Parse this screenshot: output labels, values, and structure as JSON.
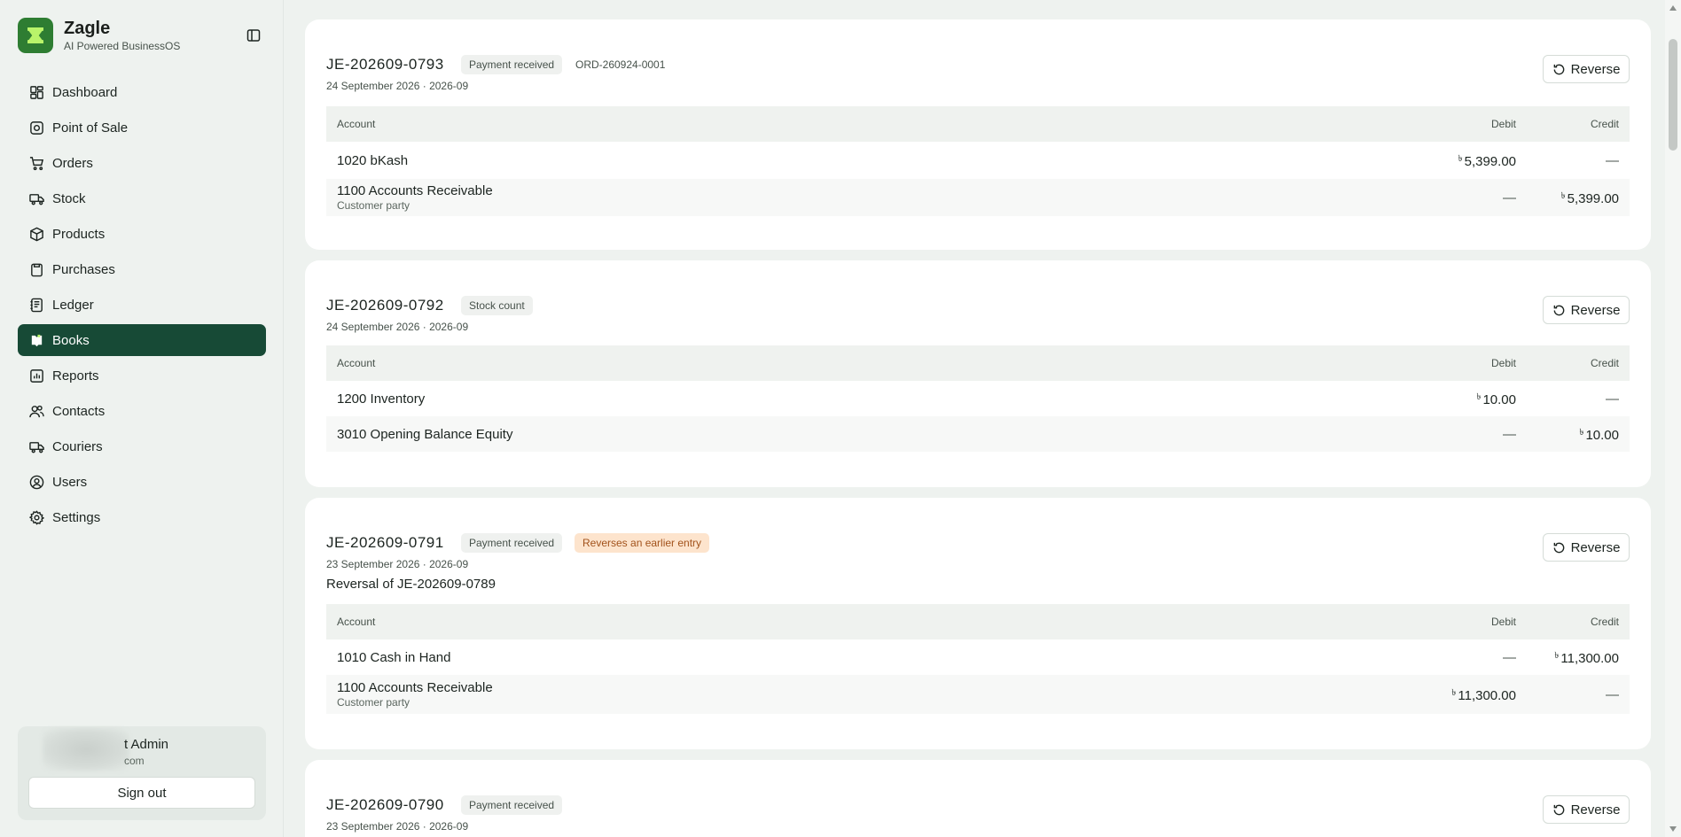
{
  "app": {
    "name": "Zagle",
    "tagline": "AI Powered BusinessOS"
  },
  "sidebar": {
    "items": [
      {
        "label": "Dashboard",
        "icon": "dashboard-icon"
      },
      {
        "label": "Point of Sale",
        "icon": "point-of-sale-icon"
      },
      {
        "label": "Orders",
        "icon": "cart-icon"
      },
      {
        "label": "Stock",
        "icon": "truck-icon"
      },
      {
        "label": "Products",
        "icon": "package-icon"
      },
      {
        "label": "Purchases",
        "icon": "clipboard-icon"
      },
      {
        "label": "Ledger",
        "icon": "book-icon"
      },
      {
        "label": "Books",
        "icon": "books-icon",
        "active": true
      },
      {
        "label": "Reports",
        "icon": "bar-chart-icon"
      },
      {
        "label": "Contacts",
        "icon": "users-icon"
      },
      {
        "label": "Couriers",
        "icon": "truck-icon"
      },
      {
        "label": "Users",
        "icon": "user-circle-icon"
      },
      {
        "label": "Settings",
        "icon": "gear-icon"
      }
    ]
  },
  "user": {
    "name_visible": "t Admin",
    "email_visible": "com",
    "signout_label": "Sign out"
  },
  "table_headers": {
    "account": "Account",
    "debit": "Debit",
    "credit": "Credit"
  },
  "currency_symbol": "৳",
  "reverse_label": "Reverse",
  "entries": [
    {
      "id": "JE-202609-0793",
      "badges": [
        "Payment received"
      ],
      "ref": "ORD-260924-0001",
      "date": "24 September 2026 · 2026-09",
      "lines": [
        {
          "account": "1020 bKash",
          "debit": "5,399.00",
          "credit": "—"
        },
        {
          "account": "1100 Accounts Receivable",
          "sub": "Customer party",
          "debit": "—",
          "credit": "5,399.00"
        }
      ]
    },
    {
      "id": "JE-202609-0792",
      "badges": [
        "Stock count"
      ],
      "date": "24 September 2026 · 2026-09",
      "lines": [
        {
          "account": "1200 Inventory",
          "debit": "10.00",
          "credit": "—"
        },
        {
          "account": "3010 Opening Balance Equity",
          "debit": "—",
          "credit": "10.00"
        }
      ]
    },
    {
      "id": "JE-202609-0791",
      "badges": [
        "Payment received",
        "Reverses an earlier entry"
      ],
      "date": "23 September 2026 · 2026-09",
      "memo": "Reversal of JE-202609-0789",
      "lines": [
        {
          "account": "1010 Cash in Hand",
          "debit": "—",
          "credit": "11,300.00"
        },
        {
          "account": "1100 Accounts Receivable",
          "sub": "Customer party",
          "debit": "11,300.00",
          "credit": "—"
        }
      ]
    },
    {
      "id": "JE-202609-0790",
      "badges": [
        "Payment received"
      ],
      "date": "23 September 2026 · 2026-09"
    }
  ],
  "colors": {
    "brand": "#2e7d32",
    "active_nav": "#174a36",
    "background": "#eef2ef",
    "badge_orange_bg": "#fde4cd",
    "badge_orange_text": "#a2521b"
  }
}
